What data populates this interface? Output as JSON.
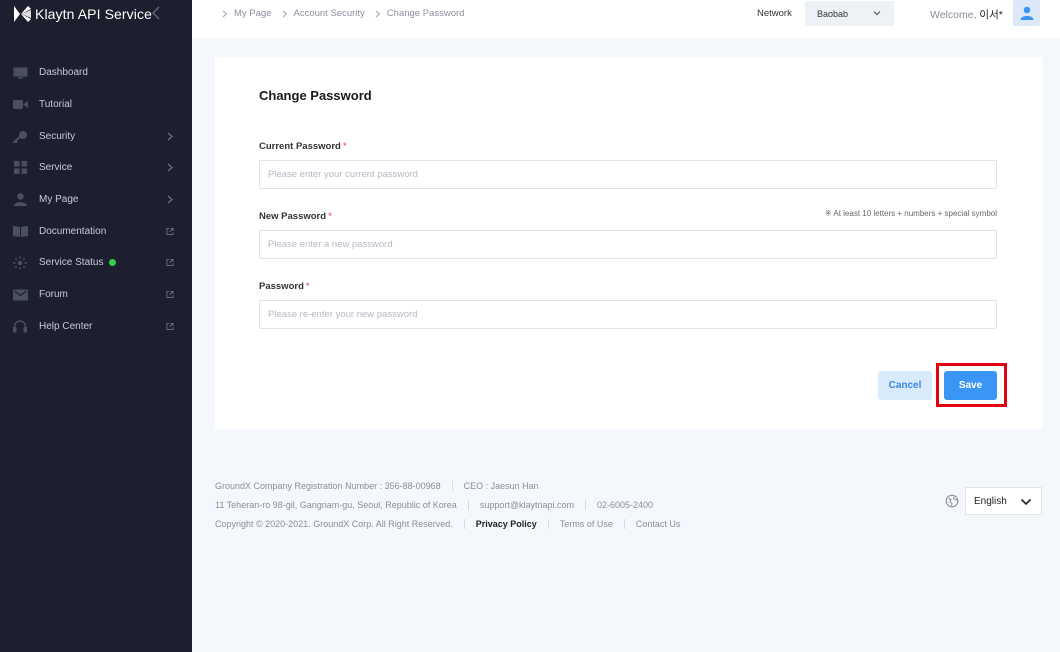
{
  "brand": {
    "name": "Klaytn API Service"
  },
  "sidebar": {
    "items": [
      {
        "label": "Dashboard",
        "icon": "monitor-icon",
        "trail": "none"
      },
      {
        "label": "Tutorial",
        "icon": "video-icon",
        "trail": "none"
      },
      {
        "label": "Security",
        "icon": "key-icon",
        "trail": "chevron"
      },
      {
        "label": "Service",
        "icon": "grid-icon",
        "trail": "chevron"
      },
      {
        "label": "My Page",
        "icon": "user-icon",
        "trail": "chevron"
      },
      {
        "label": "Documentation",
        "icon": "book-icon",
        "trail": "external"
      },
      {
        "label": "Service Status",
        "icon": "status-icon",
        "trail": "external",
        "status_color": "#2fd04a"
      },
      {
        "label": "Forum",
        "icon": "mail-icon",
        "trail": "external"
      },
      {
        "label": "Help Center",
        "icon": "headset-icon",
        "trail": "external"
      }
    ]
  },
  "header": {
    "breadcrumbs": [
      "My Page",
      "Account Security",
      "Change Password"
    ],
    "network_label": "Network",
    "network_value": "Baobab",
    "welcome_prefix": "Welcome,",
    "welcome_user": "이서*"
  },
  "form": {
    "title": "Change Password",
    "current": {
      "label": "Current Password",
      "required": "*",
      "placeholder": "Please enter your current password",
      "value": ""
    },
    "new": {
      "label": "New Password",
      "required": "*",
      "placeholder": "Please enter a new password",
      "value": "",
      "hint": "※ At least 10 letters + numbers + special symbol"
    },
    "confirm": {
      "label": "Password",
      "required": "*",
      "placeholder": "Please re-enter your new password",
      "value": ""
    },
    "cancel_label": "Cancel",
    "save_label": "Save"
  },
  "footer": {
    "registration": "GroundX Company Registration Number : 356-88-00968",
    "ceo": "CEO : Jaesun Han",
    "address": "11 Teheran-ro 98-gil, Gangnam-gu, Seoul, Republic of Korea",
    "email": "support@klaytnapi.com",
    "phone": "02-6005-2400",
    "copyright": "Copyright © 2020-2021. GroundX Corp. All Right Reserved.",
    "privacy": "Privacy Policy",
    "terms": "Terms of Use",
    "contact": "Contact Us",
    "language": "English"
  },
  "colors": {
    "sidebar_bg": "#1e1f2e",
    "accent": "#3a95f5",
    "highlight": "#e3000f",
    "status_ok": "#2fd04a"
  }
}
